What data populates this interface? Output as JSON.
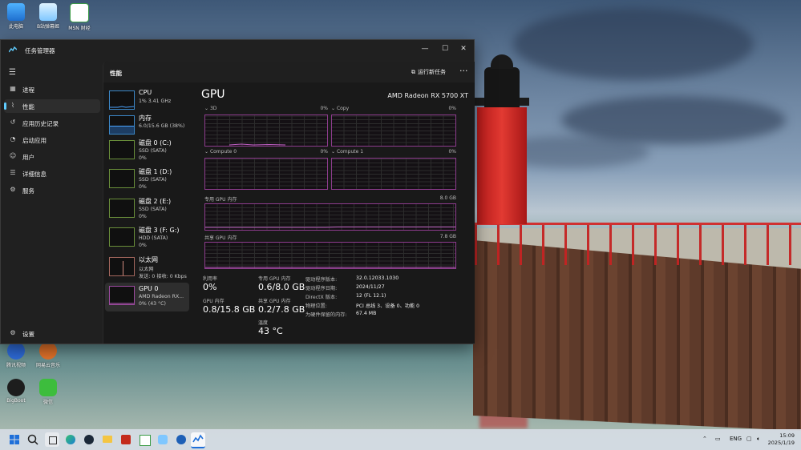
{
  "desktop": {
    "icons": [
      {
        "label": "此电脑"
      },
      {
        "label": "B站弹幕姬"
      },
      {
        "label": "MSN 财经"
      },
      {
        "label": "腾讯视频"
      },
      {
        "label": "网易云音乐"
      },
      {
        "label": "BigBoot"
      },
      {
        "label": "微信"
      }
    ]
  },
  "window": {
    "title": "任务管理器",
    "controls": {
      "minimize": "—",
      "maximize": "☐",
      "close": "✕"
    }
  },
  "nav": {
    "menu_icon": "☰",
    "items": [
      {
        "label": "进程",
        "icon": "processes-icon"
      },
      {
        "label": "性能",
        "icon": "performance-icon"
      },
      {
        "label": "应用历史记录",
        "icon": "history-icon"
      },
      {
        "label": "启动应用",
        "icon": "startup-icon"
      },
      {
        "label": "用户",
        "icon": "users-icon"
      },
      {
        "label": "详细信息",
        "icon": "details-icon"
      },
      {
        "label": "服务",
        "icon": "services-icon"
      }
    ],
    "settings": "设置"
  },
  "header": {
    "title": "性能",
    "run_task": "运行新任务",
    "more": "···"
  },
  "devices": [
    {
      "name": "CPU",
      "line1": "1%  3.41 GHz",
      "line2": ""
    },
    {
      "name": "内存",
      "line1": "6.0/15.6 GB (38%)",
      "line2": ""
    },
    {
      "name": "磁盘 0 (C:)",
      "line1": "SSD (SATA)",
      "line2": "0%"
    },
    {
      "name": "磁盘 1 (D:)",
      "line1": "SSD (SATA)",
      "line2": "0%"
    },
    {
      "name": "磁盘 2 (E:)",
      "line1": "SSD (SATA)",
      "line2": "0%"
    },
    {
      "name": "磁盘 3 (F: G:)",
      "line1": "HDD (SATA)",
      "line2": "0%"
    },
    {
      "name": "以太网",
      "line1": "以太网",
      "line2": "发送: 0 接收: 0 Kbps"
    },
    {
      "name": "GPU 0",
      "line1": "AMD Radeon RX...",
      "line2": "0% (43 °C)"
    }
  ],
  "gpu": {
    "title": "GPU",
    "model": "AMD Radeon RX 5700 XT",
    "engines": [
      {
        "label": "3D",
        "pct": "0%"
      },
      {
        "label": "Copy",
        "pct": "0%"
      },
      {
        "label": "Compute 0",
        "pct": "0%"
      },
      {
        "label": "Compute 1",
        "pct": "0%"
      }
    ],
    "dedicated": {
      "label": "专用 GPU 内存",
      "max": "8.0 GB"
    },
    "shared": {
      "label": "共享 GPU 内存",
      "max": "7.8 GB"
    },
    "stats": {
      "utilization": {
        "label": "利用率",
        "value": "0%"
      },
      "dedicated_mem": {
        "label": "专用 GPU 内存",
        "value": "0.6/8.0 GB"
      },
      "gpu_mem": {
        "label": "GPU 内存",
        "value": "0.8/15.8 GB"
      },
      "shared_mem": {
        "label": "共享 GPU 内存",
        "value": "0.2/7.8 GB"
      },
      "temperature": {
        "label": "温度",
        "value": "43 °C"
      }
    },
    "info": [
      {
        "key": "驱动程序版本:",
        "value": "32.0.12033.1030"
      },
      {
        "key": "驱动程序日期:",
        "value": "2024/11/27"
      },
      {
        "key": "DirectX 版本:",
        "value": "12 (FL 12.1)"
      },
      {
        "key": "物理位置:",
        "value": "PCI 总线 3、设备 0、功能 0"
      },
      {
        "key": "为硬件保留的内存:",
        "value": "67.4 MB"
      }
    ]
  },
  "taskbar": {
    "lang": "ENG",
    "time": "15:09",
    "date": "2025/1/19",
    "accent": "#60cdff"
  }
}
